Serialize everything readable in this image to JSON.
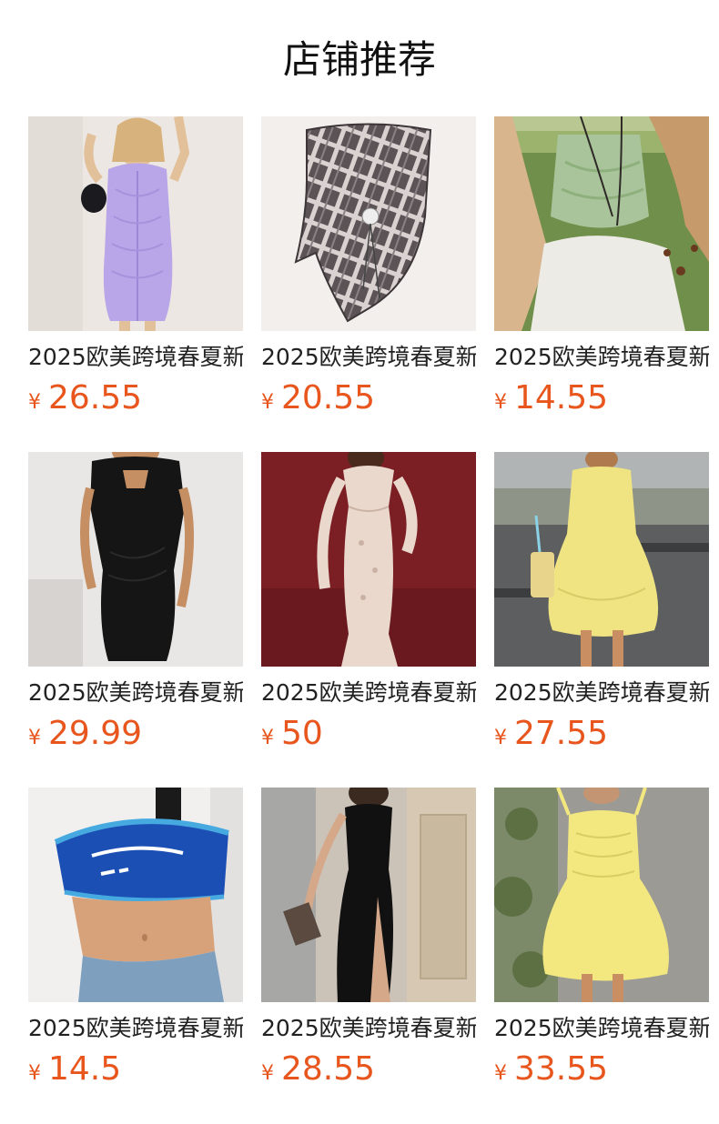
{
  "section_title": "店铺推荐",
  "colors": {
    "price": "#e8561e",
    "text": "#222222",
    "background": "#ffffff"
  },
  "products": [
    {
      "name": "2025欧美跨境春夏新",
      "currency": "¥",
      "price": "26.55",
      "image": "lavender-ruched-shirt-dress"
    },
    {
      "name": "2025欧美跨境春夏新",
      "currency": "¥",
      "price": "20.55",
      "image": "plaid-tube-top"
    },
    {
      "name": "2025欧美跨境春夏新",
      "currency": "¥",
      "price": "14.55",
      "image": "green-satin-cami"
    },
    {
      "name": "2025欧美跨境春夏新",
      "currency": "¥",
      "price": "29.99",
      "image": "black-bodycon-dress"
    },
    {
      "name": "2025欧美跨境春夏新",
      "currency": "¥",
      "price": "50",
      "image": "lace-maxi-dress"
    },
    {
      "name": "2025欧美跨境春夏新",
      "currency": "¥",
      "price": "27.55",
      "image": "yellow-flare-dress"
    },
    {
      "name": "2025欧美跨境春夏新",
      "currency": "¥",
      "price": "14.5",
      "image": "blue-crop-tee"
    },
    {
      "name": "2025欧美跨境春夏新",
      "currency": "¥",
      "price": "28.55",
      "image": "black-slit-maxi-dress"
    },
    {
      "name": "2025欧美跨境春夏新",
      "currency": "¥",
      "price": "33.55",
      "image": "yellow-ruched-mini-dress"
    }
  ]
}
